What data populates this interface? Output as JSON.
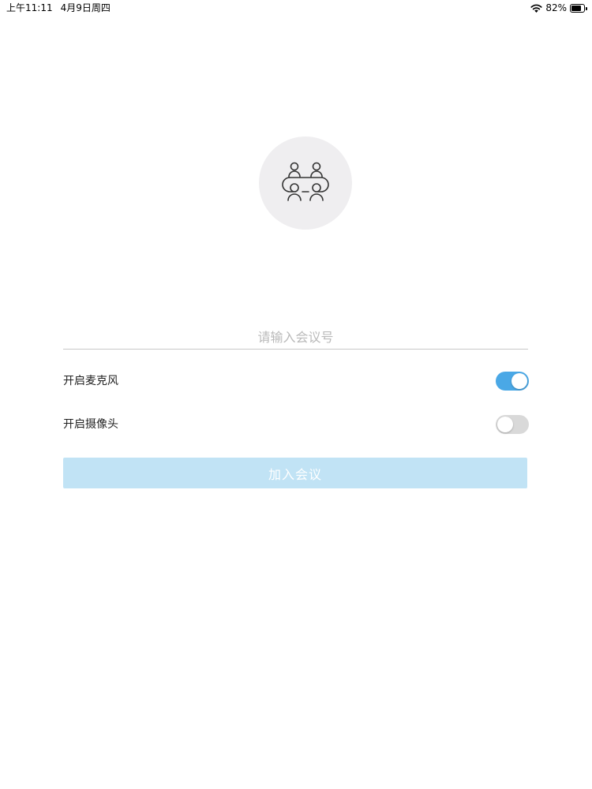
{
  "status_bar": {
    "time": "上午11:11",
    "date": "4月9日周四",
    "battery": "82%",
    "battery_level": 0.82,
    "icons": [
      "wifi-icon",
      "battery-icon"
    ]
  },
  "illustration": {
    "icon": "meeting-table-icon",
    "background_color": "#efeef0"
  },
  "meeting_input": {
    "value": "",
    "placeholder": "请输入会议号"
  },
  "options": {
    "microphone": {
      "label": "开启麦克风",
      "enabled": true
    },
    "camera": {
      "label": "开启摄像头",
      "enabled": false
    }
  },
  "join_button": {
    "label": "加入会议",
    "enabled": false
  },
  "colors": {
    "toggle_on": "#4aa8e6",
    "toggle_off": "#d9d9d9",
    "button_disabled_bg": "#c1e3f5",
    "divider": "#c8c8c8"
  }
}
